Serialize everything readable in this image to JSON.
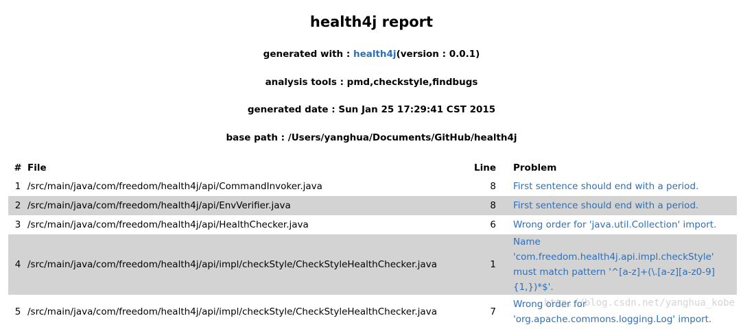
{
  "title": "health4j report",
  "meta": {
    "generated_with_label": "generated with : ",
    "generated_with_link": "health4j",
    "generated_with_version": "(version : 0.0.1)",
    "analysis_tools": "analysis tools : pmd,checkstyle,findbugs",
    "generated_date": "generated date : Sun Jan 25 17:29:41 CST 2015",
    "base_path": "base path : /Users/yanghua/Documents/GitHub/health4j"
  },
  "table": {
    "headers": {
      "num": "#",
      "file": "File",
      "line": "Line",
      "problem": "Problem"
    },
    "rows": [
      {
        "num": "1",
        "file": "/src/main/java/com/freedom/health4j/api/CommandInvoker.java",
        "line": "8",
        "problem": "First sentence should end with a period."
      },
      {
        "num": "2",
        "file": "/src/main/java/com/freedom/health4j/api/EnvVerifier.java",
        "line": "8",
        "problem": "First sentence should end with a period."
      },
      {
        "num": "3",
        "file": "/src/main/java/com/freedom/health4j/api/HealthChecker.java",
        "line": "6",
        "problem": "Wrong order for 'java.util.Collection' import."
      },
      {
        "num": "4",
        "file": "/src/main/java/com/freedom/health4j/api/impl/checkStyle/CheckStyleHealthChecker.java",
        "line": "1",
        "problem": "Name 'com.freedom.health4j.api.impl.checkStyle' must match pattern '^[a-z]+(\\.[a-z][a-z0-9]{1,})*$'."
      },
      {
        "num": "5",
        "file": "/src/main/java/com/freedom/health4j/api/impl/checkStyle/CheckStyleHealthChecker.java",
        "line": "7",
        "problem": "Wrong order for 'org.apache.commons.logging.Log' import."
      }
    ]
  },
  "watermark": "http://blog.csdn.net/yanghua_kobe",
  "colors": {
    "link": "#2f6fb5",
    "stripe": "#d3d3d3"
  }
}
